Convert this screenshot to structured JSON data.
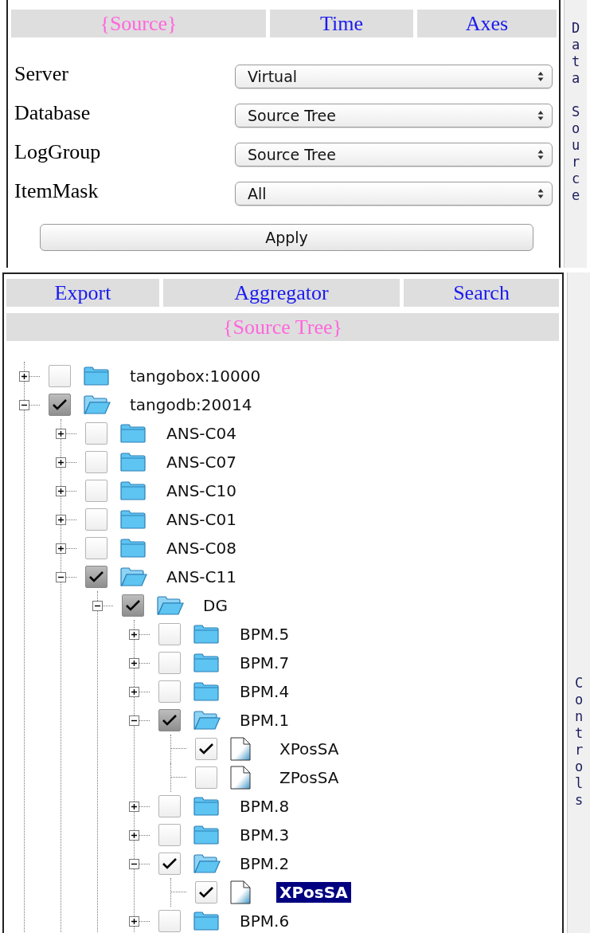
{
  "top_panel": {
    "tabs": [
      {
        "label": "{Source}",
        "selected": true
      },
      {
        "label": "Time",
        "selected": false
      },
      {
        "label": "Axes",
        "selected": false
      }
    ],
    "fields": [
      {
        "label": "Server",
        "value": "Virtual"
      },
      {
        "label": "Database",
        "value": "Source Tree"
      },
      {
        "label": "LogGroup",
        "value": "Source Tree"
      },
      {
        "label": "ItemMask",
        "value": "All"
      }
    ],
    "apply_button": "Apply"
  },
  "top_side_tab": "Data Source",
  "bottom_panel": {
    "tab_rows": [
      [
        {
          "label": "Export",
          "selected": false
        },
        {
          "label": "Aggregator",
          "selected": false
        },
        {
          "label": "Search",
          "selected": false
        }
      ],
      [
        {
          "label": "{Source Tree}",
          "selected": true
        }
      ]
    ],
    "tree": [
      {
        "label": "tangobox:10000",
        "kind": "folder",
        "expanded": false,
        "checked": false,
        "partial": false,
        "selected": false
      },
      {
        "label": "tangodb:20014",
        "kind": "folder",
        "expanded": true,
        "checked": true,
        "partial": true,
        "selected": false,
        "children": [
          {
            "label": "ANS-C04",
            "kind": "folder",
            "expanded": false,
            "checked": false,
            "partial": false,
            "selected": false
          },
          {
            "label": "ANS-C07",
            "kind": "folder",
            "expanded": false,
            "checked": false,
            "partial": false,
            "selected": false
          },
          {
            "label": "ANS-C10",
            "kind": "folder",
            "expanded": false,
            "checked": false,
            "partial": false,
            "selected": false
          },
          {
            "label": "ANS-C01",
            "kind": "folder",
            "expanded": false,
            "checked": false,
            "partial": false,
            "selected": false
          },
          {
            "label": "ANS-C08",
            "kind": "folder",
            "expanded": false,
            "checked": false,
            "partial": false,
            "selected": false
          },
          {
            "label": "ANS-C11",
            "kind": "folder",
            "expanded": true,
            "checked": true,
            "partial": true,
            "selected": false,
            "children": [
              {
                "label": "DG",
                "kind": "folder",
                "expanded": true,
                "checked": true,
                "partial": true,
                "selected": false,
                "children": [
                  {
                    "label": "BPM.5",
                    "kind": "folder",
                    "expanded": false,
                    "checked": false,
                    "partial": false,
                    "selected": false
                  },
                  {
                    "label": "BPM.7",
                    "kind": "folder",
                    "expanded": false,
                    "checked": false,
                    "partial": false,
                    "selected": false
                  },
                  {
                    "label": "BPM.4",
                    "kind": "folder",
                    "expanded": false,
                    "checked": false,
                    "partial": false,
                    "selected": false
                  },
                  {
                    "label": "BPM.1",
                    "kind": "folder",
                    "expanded": true,
                    "checked": true,
                    "partial": true,
                    "selected": false,
                    "children": [
                      {
                        "label": "XPosSA",
                        "kind": "leaf",
                        "checked": true,
                        "partial": false,
                        "selected": false
                      },
                      {
                        "label": "ZPosSA",
                        "kind": "leaf",
                        "checked": false,
                        "partial": false,
                        "selected": false
                      }
                    ]
                  },
                  {
                    "label": "BPM.8",
                    "kind": "folder",
                    "expanded": false,
                    "checked": false,
                    "partial": false,
                    "selected": false
                  },
                  {
                    "label": "BPM.3",
                    "kind": "folder",
                    "expanded": false,
                    "checked": false,
                    "partial": false,
                    "selected": false
                  },
                  {
                    "label": "BPM.2",
                    "kind": "folder",
                    "expanded": true,
                    "checked": true,
                    "partial": false,
                    "selected": false,
                    "children": [
                      {
                        "label": "XPosSA",
                        "kind": "leaf",
                        "checked": true,
                        "partial": false,
                        "selected": true
                      }
                    ]
                  },
                  {
                    "label": "BPM.6",
                    "kind": "folder",
                    "expanded": false,
                    "checked": false,
                    "partial": false,
                    "selected": false
                  }
                ]
              }
            ]
          }
        ]
      }
    ]
  },
  "bottom_side_tab": "Controls"
}
